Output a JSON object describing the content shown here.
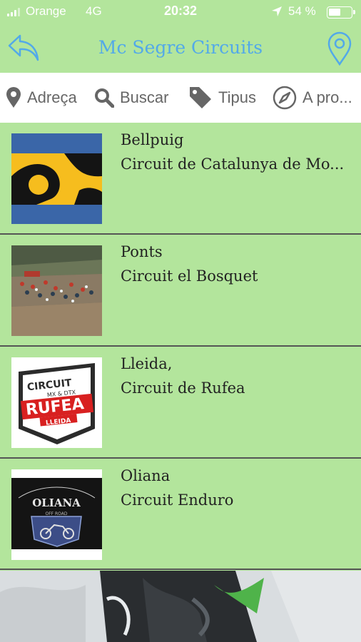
{
  "status_bar": {
    "carrier": "Orange",
    "network": "4G",
    "time": "20:32",
    "battery": "54 %",
    "battery_level": 0.54,
    "location_icon": "location-arrow-icon"
  },
  "nav": {
    "title": "Mc Segre Circuits",
    "back_icon": "back-arrow-icon",
    "map_icon": "map-pin-icon",
    "accent_color": "#52a9e9"
  },
  "filters": [
    {
      "label": "Adreça",
      "icon": "map-marker-icon"
    },
    {
      "label": "Buscar",
      "icon": "search-icon"
    },
    {
      "label": "Tipus",
      "icon": "tag-icon"
    },
    {
      "label": "A pro...",
      "icon": "compass-icon"
    }
  ],
  "items": [
    {
      "title": "Bellpuig",
      "subtitle": "Circuit de Catalunya de Mo...",
      "thumb": "circuit-logo-bellpuig"
    },
    {
      "title": "Ponts",
      "subtitle": "Circuit el Bosquet",
      "thumb": "motocross-race-photo"
    },
    {
      "title": "Lleida,",
      "subtitle": "Circuit de Rufea",
      "thumb": "rufea-logo",
      "logo_text": {
        "line1": "CIRCUIT",
        "line2": "MX & DTX",
        "line3": "RUFEA",
        "line4": "LLEIDA"
      }
    },
    {
      "title": "Oliana",
      "subtitle": "Circuit Enduro",
      "thumb": "oliana-logo",
      "logo_text": {
        "line1": "OLIANA",
        "line2": "OFF ROAD"
      }
    }
  ],
  "colors": {
    "background": "#b3e59c",
    "filter_bar": "#ffffff",
    "list_divider": "#555555"
  }
}
